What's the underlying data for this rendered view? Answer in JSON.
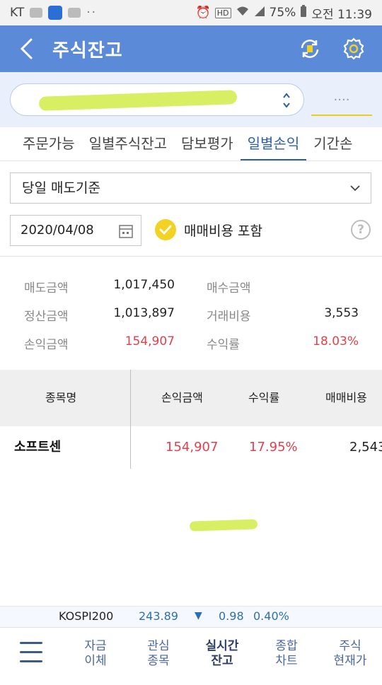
{
  "status_bar": {
    "carrier": "KT",
    "battery": "75%",
    "time": "오전 11:39",
    "dots": "··"
  },
  "header": {
    "title": "주식잔고"
  },
  "account": {
    "password_placeholder": "····"
  },
  "tabs": [
    {
      "label": "주문가능",
      "active": false
    },
    {
      "label": "일별주식잔고",
      "active": false
    },
    {
      "label": "담보평가",
      "active": false
    },
    {
      "label": "일별손익",
      "active": true
    },
    {
      "label": "기간손",
      "active": false
    }
  ],
  "filter": {
    "basis": "당일 매도기준",
    "date": "2020/04/08",
    "include_fees_label": "매매비용 포함",
    "help": "?"
  },
  "summary": [
    {
      "k1": "매도금액",
      "v1": "1,017,450",
      "k2": "매수금액",
      "v2": ""
    },
    {
      "k1": "정산금액",
      "v1": "1,013,897",
      "k2": "거래비용",
      "v2": "3,553"
    },
    {
      "k1": "손익금액",
      "v1": "154,907",
      "k2": "수익률",
      "v2": "18.03%"
    }
  ],
  "table": {
    "headers": [
      "종목명",
      "손익금액",
      "수익률",
      "매매비용"
    ],
    "rows": [
      {
        "name": "소프트센",
        "pnl": "154,907",
        "rate": "17.95%",
        "fee": "2,543"
      }
    ]
  },
  "ticker": {
    "name": "KOSPI200",
    "value": "243.89",
    "arrow": "▼",
    "change": "0.98",
    "pct": "0.40%"
  },
  "bottom_nav": [
    {
      "line1": "자금",
      "line2": "이체",
      "active": false
    },
    {
      "line1": "관심",
      "line2": "종목",
      "active": false
    },
    {
      "line1": "실시간",
      "line2": "잔고",
      "active": true
    },
    {
      "line1": "종합",
      "line2": "차트",
      "active": false
    },
    {
      "line1": "주식",
      "line2": "현재가",
      "active": false
    }
  ],
  "colors": {
    "header_blue": "#5b8bd8",
    "active_tab": "#2d5fa6",
    "profit_red": "#e2414b",
    "ticker_blue": "#2e6fb0",
    "check_yellow": "#f2d223"
  }
}
